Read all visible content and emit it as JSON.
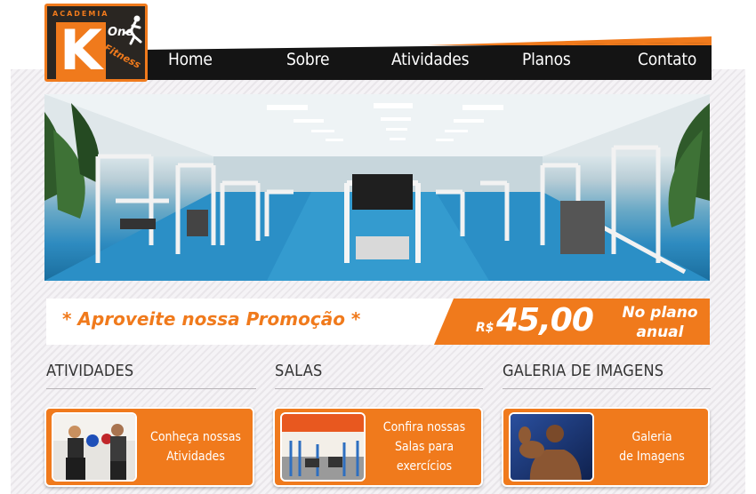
{
  "logo": {
    "academy_text": "ACADEMIA",
    "letter": "K",
    "one_text": "One",
    "fitness_text": "Fitness"
  },
  "nav": {
    "items": [
      "Home",
      "Sobre",
      "Atividades",
      "Planos",
      "Contato"
    ]
  },
  "promo": {
    "headline": "* Aproveite nossa Promoção *",
    "currency": "R$",
    "price": "45,00",
    "plan_line1": "No plano",
    "plan_line2": "anual"
  },
  "sections": [
    {
      "title": "ATIVIDADES",
      "card_text": "Conheça nossas\nAtividades"
    },
    {
      "title": "SALAS",
      "card_text": "Confira nossas\nSalas para\nexercícios"
    },
    {
      "title": "GALERIA DE IMAGENS",
      "card_text": "Galeria\nde Imagens"
    }
  ],
  "colors": {
    "accent": "#f07a1c",
    "nav_bg": "#141414",
    "text_dark": "#333333"
  }
}
